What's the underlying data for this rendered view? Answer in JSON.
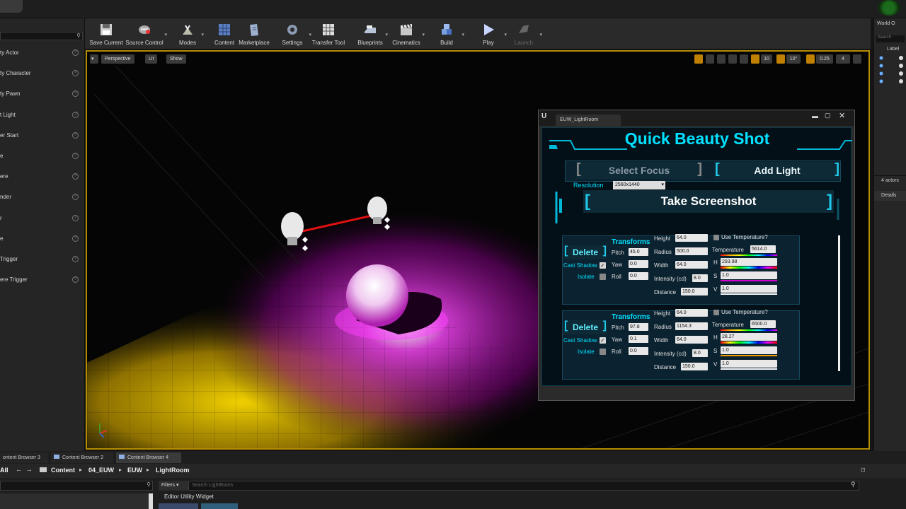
{
  "toolbar": {
    "items": [
      {
        "label": "Save Current",
        "icon": "save-icon"
      },
      {
        "label": "Source Control",
        "icon": "source-control-icon"
      },
      {
        "label": "Modes",
        "icon": "modes-icon"
      },
      {
        "label": "Content",
        "icon": "content-icon"
      },
      {
        "label": "Marketplace",
        "icon": "marketplace-icon"
      },
      {
        "label": "Settings",
        "icon": "settings-icon"
      },
      {
        "label": "Transfer Tool",
        "icon": "transfer-tool-icon"
      },
      {
        "label": "Blueprints",
        "icon": "blueprints-icon"
      },
      {
        "label": "Cinematics",
        "icon": "cinematics-icon"
      },
      {
        "label": "Build",
        "icon": "build-icon"
      },
      {
        "label": "Play",
        "icon": "play-icon"
      },
      {
        "label": "Launch",
        "icon": "launch-icon"
      }
    ]
  },
  "place_actors": {
    "items": [
      "ty Actor",
      "ty Character",
      "ty Pawn",
      "t Light",
      "er Start",
      "e",
      "ere",
      "nder",
      "r",
      "e",
      " Trigger",
      "ere Trigger"
    ]
  },
  "viewport": {
    "perspective": "Perspective",
    "lit": "Lit",
    "show": "Show",
    "grid_snap": "10",
    "rot_snap": "10°",
    "scale_snap": "0.25",
    "camera_speed": "4"
  },
  "outliner": {
    "title": "World O",
    "search_placeholder": "Search",
    "label_col": "Label",
    "actors_count": "4 actors",
    "details_tab": "Details"
  },
  "widget": {
    "tab": "EUW_LightRoom",
    "title": "Quick Beauty Shot",
    "select_focus": "Select Focus",
    "add_light": "Add Light",
    "resolution_label": "Resolution",
    "resolution_value": "2560x1440",
    "take_screenshot": "Take Screenshot",
    "lights": [
      {
        "delete": "Delete",
        "transforms": "Transforms",
        "cast_shadow": "Cast Shadow",
        "isolate": "Isolate",
        "pitch_label": "Pitch",
        "pitch": "45.0",
        "yaw_label": "Yaw",
        "yaw": "0.0",
        "roll_label": "Roll",
        "roll": "0.0",
        "height_label": "Height",
        "height": "64.0",
        "radius_label": "Radius",
        "radius": "500.0",
        "width_label": "Width",
        "width": "64.0",
        "intensity_label": "Intensity (cd)",
        "intensity": "8.0",
        "distance_label": "Distance",
        "distance": "150.0",
        "use_temp": "Use Temperature?",
        "temperature_label": "Temperature",
        "temperature": "5614.0",
        "h": "293.98",
        "s": "1.0",
        "v": "1.0"
      },
      {
        "delete": "Delete",
        "transforms": "Transforms",
        "cast_shadow": "Cast Shadow",
        "isolate": "Isolate",
        "pitch_label": "Pitch",
        "pitch": "97.8",
        "yaw_label": "Yaw",
        "yaw": "0.1",
        "roll_label": "Roll",
        "roll": "0.0",
        "height_label": "Height",
        "height": "64.0",
        "radius_label": "Radius",
        "radius": "1154.3",
        "width_label": "Width",
        "width": "64.0",
        "intensity_label": "Intensity (cd)",
        "intensity": "8.0",
        "distance_label": "Distance",
        "distance": "150.0",
        "use_temp": "Use Temperature?",
        "temperature_label": "Temperature",
        "temperature": "6500.0",
        "h": "28.27",
        "s": "1.0",
        "v": "1.0"
      }
    ]
  },
  "content_browser": {
    "tabs": [
      "ontent Browser 3",
      "Content Browser 2",
      "Content Browser 4"
    ],
    "all": "All",
    "path": [
      "Content",
      "04_EUW",
      "EUW",
      "LightRoom"
    ],
    "filters": "Filters",
    "search_placeholder": "Search LightRoom",
    "folder_item": "Editor Utility Widget"
  },
  "colors": {
    "accent": "#00e1ff",
    "viewport_border": "#b48c00",
    "magenta": "#d400d4",
    "yellow": "#f0d000"
  }
}
